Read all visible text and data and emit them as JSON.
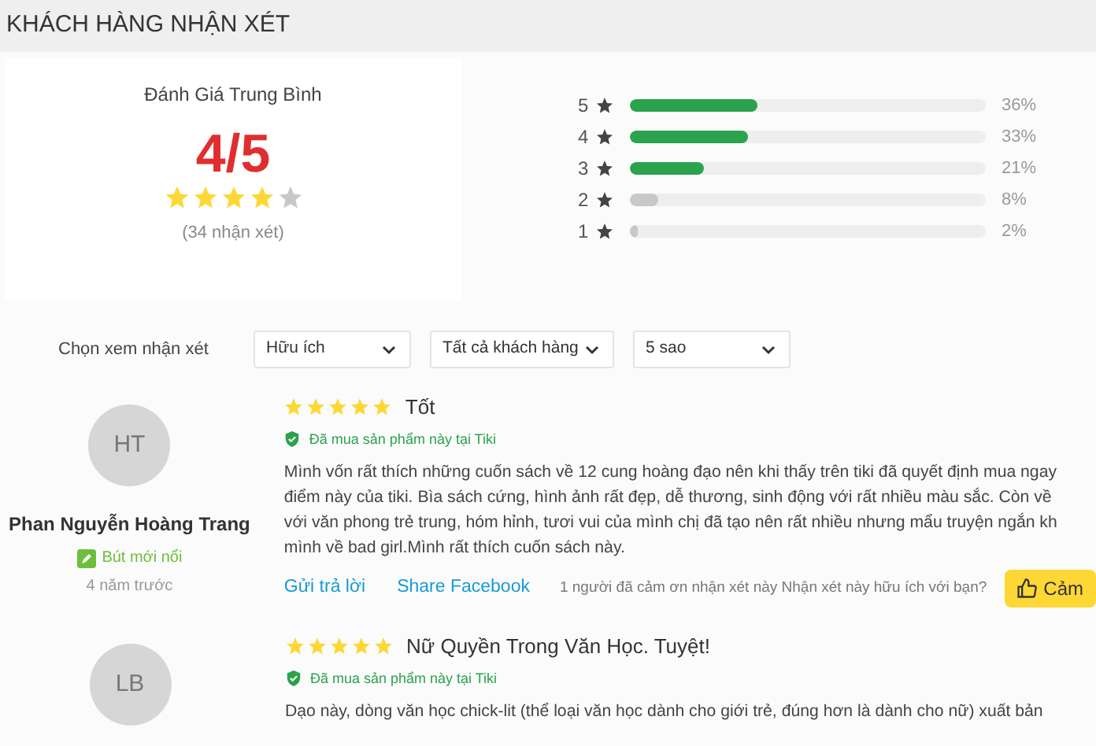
{
  "header": {
    "title": "KHÁCH HÀNG NHẬN XÉT"
  },
  "summary": {
    "title": "Đánh Giá Trung Bình",
    "score": "4/5",
    "stars": 4,
    "count": "(34 nhận xét)"
  },
  "distribution": [
    {
      "label": "5",
      "level": 0.36,
      "percent": "36%",
      "highlight": true
    },
    {
      "label": "4",
      "level": 0.33,
      "percent": "33%",
      "highlight": true
    },
    {
      "label": "3",
      "level": 0.21,
      "percent": "21%",
      "highlight": true
    },
    {
      "label": "2",
      "level": 0.08,
      "percent": "8%",
      "highlight": false
    },
    {
      "label": "1",
      "level": 0.02,
      "percent": "2%",
      "highlight": false
    }
  ],
  "filters": {
    "label": "Chọn xem nhận xét",
    "dropdowns": [
      "Hữu ích",
      "Tất cả khách hàng",
      "5 sao"
    ]
  },
  "reviews": [
    {
      "initials": "HT",
      "name": "Phan Nguyễn Hoàng Trang",
      "badge": "Bút mới nổi",
      "time": "4 năm trước",
      "stars": 5,
      "title": "Tốt",
      "verified": "Đã mua sản phẩm này tại Tiki",
      "body_lines": [
        "Mình vốn rất thích những cuốn sách về 12 cung hoàng đạo nên khi thấy trên tiki đã quyết định mua ngay",
        "điểm này của tiki. Bìa sách cứng, hình ảnh rất đẹp, dễ thương, sinh động với rất nhiều màu sắc. Còn về",
        "với văn phong trẻ trung, hóm hỉnh, tươi vui của mình chị đã tạo nên rất nhiều nhưng mẩu truyện ngắn kh",
        "mình về bad girl.Mình rất thích cuốn sách này."
      ],
      "reply": "Gửi trả lời",
      "share": "Share Facebook",
      "thanks": "1 người đã cảm ơn nhận xét này Nhận xét này hữu ích với bạn?",
      "thank_button": "Cảm"
    },
    {
      "initials": "LB",
      "stars": 5,
      "title": "Nữ Quyền Trong Văn Học. Tuyệt!",
      "verified": "Đã mua sản phẩm này tại Tiki",
      "body_lines": [
        "Dạo này, dòng văn học chick-lit (thể loại văn học dành cho giới trẻ, đúng hơn là dành cho nữ) xuất bản"
      ]
    }
  ]
}
